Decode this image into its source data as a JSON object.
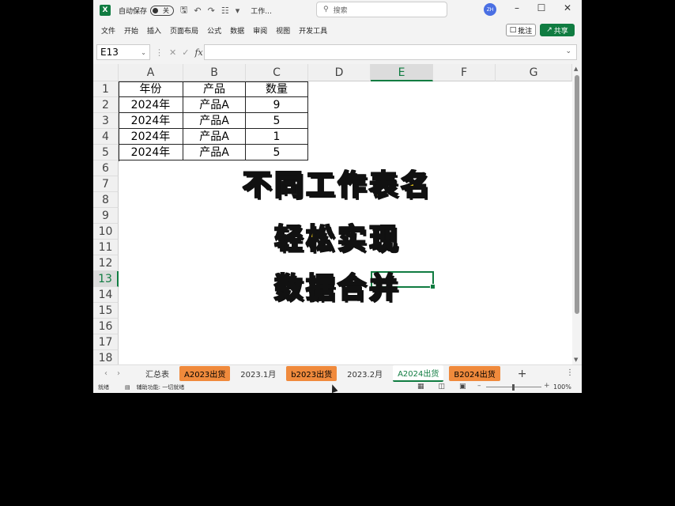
{
  "titlebar": {
    "autosave_label": "自动保存",
    "autosave_state": "关",
    "doc_title": "工作...",
    "search_placeholder": "搜索",
    "avatar_initials": "ZH"
  },
  "menu": [
    "文件",
    "开始",
    "插入",
    "页面布局",
    "公式",
    "数据",
    "审阅",
    "视图",
    "开发工具"
  ],
  "actions": {
    "comment": "批注",
    "share": "共享"
  },
  "formula_bar": {
    "name_box": "E13",
    "formula": ""
  },
  "columns": [
    "A",
    "B",
    "C",
    "D",
    "E",
    "F",
    "G"
  ],
  "rows": [
    "1",
    "2",
    "3",
    "4",
    "5",
    "6",
    "7",
    "8",
    "9",
    "10",
    "11",
    "12",
    "13",
    "14",
    "15",
    "16",
    "17",
    "18"
  ],
  "table": {
    "headers": [
      "年份",
      "产品",
      "数量"
    ],
    "rows": [
      [
        "2024年",
        "产品A",
        "9"
      ],
      [
        "2024年",
        "产品A",
        "5"
      ],
      [
        "2024年",
        "产品A",
        "1"
      ],
      [
        "2024年",
        "产品A",
        "5"
      ]
    ]
  },
  "overlay_lines": [
    "不同工作表名",
    "轻松实现",
    "数据合并"
  ],
  "sheet_tabs": [
    {
      "name": "汇总表",
      "style": "plain"
    },
    {
      "name": "A2023出货",
      "style": "orange"
    },
    {
      "name": "2023.1月",
      "style": "plain"
    },
    {
      "name": "b2023出货",
      "style": "orange"
    },
    {
      "name": "2023.2月",
      "style": "plain"
    },
    {
      "name": "A2024出货",
      "style": "active"
    },
    {
      "name": "B2024出货",
      "style": "orange"
    }
  ],
  "status": {
    "ready": "就绪",
    "accessibility": "辅助功能: 一切就绪",
    "zoom": "100%"
  },
  "colors": {
    "excel_green": "#107c41",
    "tab_orange": "#f08a3c",
    "overlay_yellow": "#f7d21a"
  }
}
